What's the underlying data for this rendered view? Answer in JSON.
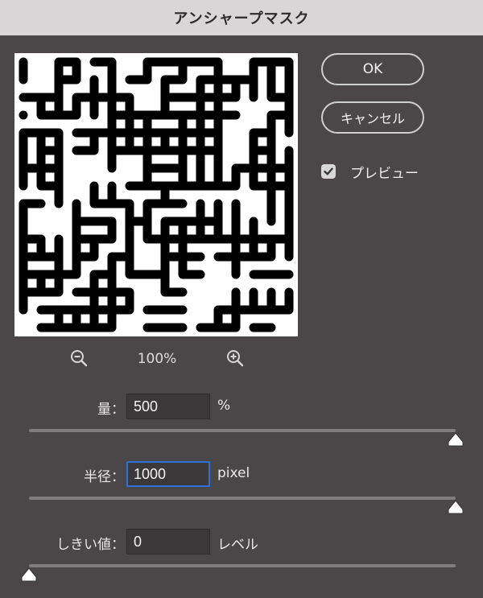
{
  "dialog": {
    "title": "アンシャープマスク"
  },
  "buttons": {
    "ok_label": "OK",
    "cancel_label": "キャンセル"
  },
  "preview_option": {
    "label": "プレビュー",
    "checked": true
  },
  "zoom": {
    "level": "100%",
    "zoom_out_icon": "zoom-out-icon",
    "zoom_in_icon": "zoom-in-icon"
  },
  "params": {
    "amount": {
      "label": "量：",
      "value": "500",
      "unit": "%",
      "slider_fraction": 1.0
    },
    "radius": {
      "label": "半径：",
      "value": "1000",
      "unit": "pixel",
      "slider_fraction": 1.0
    },
    "threshold": {
      "label": "しきい値：",
      "value": "0",
      "unit": "レベル",
      "slider_fraction": 0.0
    }
  },
  "colors": {
    "background": "#4b4748",
    "titlebar": "#d8d6d6",
    "focus_ring": "#2f6fd6",
    "input_bg": "#3b3839"
  }
}
